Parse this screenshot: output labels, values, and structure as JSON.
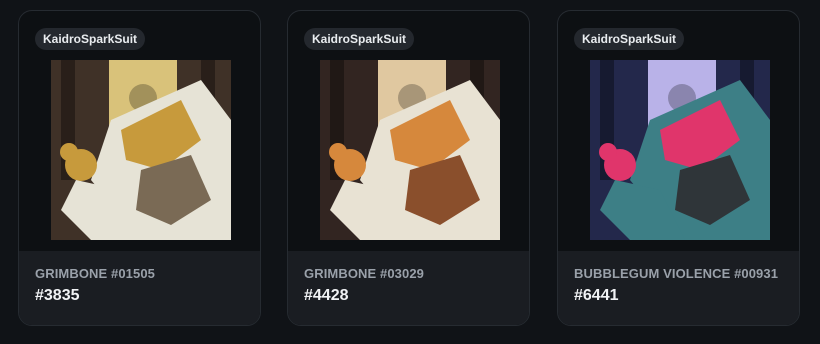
{
  "cards": [
    {
      "tag": "KaidroSparkSuit",
      "name": "GRIMBONE #01505",
      "number": "#3835",
      "art": {
        "bg": "#4a3a2e",
        "banner": "#d9c27a",
        "suit": "#e6e3d6",
        "accent": "#c79a3c",
        "trim": "#7a6a55"
      }
    },
    {
      "tag": "KaidroSparkSuit",
      "name": "GRIMBONE #03029",
      "number": "#4428",
      "art": {
        "bg": "#3b2c27",
        "banner": "#e0c8a0",
        "suit": "#e8e2d3",
        "accent": "#d6883c",
        "trim": "#8a4f2c"
      }
    },
    {
      "tag": "KaidroSparkSuit",
      "name": "BUBBLEGUM VIOLENCE #00931",
      "number": "#6441",
      "art": {
        "bg": "#2a2f59",
        "banner": "#b9b2e8",
        "suit": "#3d7f86",
        "accent": "#e0356b",
        "trim": "#2f3539"
      }
    }
  ]
}
